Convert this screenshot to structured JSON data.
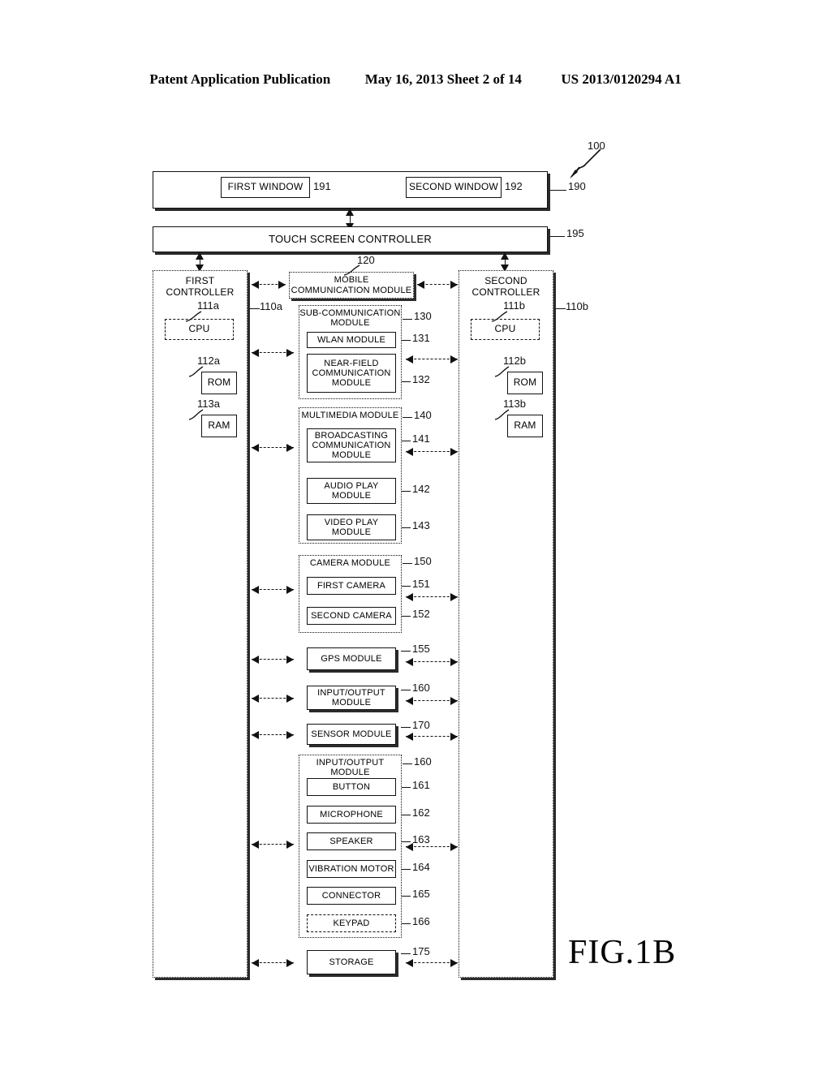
{
  "header": {
    "publication": "Patent Application Publication",
    "date_sheet": "May 16, 2013  Sheet 2 of 14",
    "patent_number": "US 2013/0120294 A1"
  },
  "figure": {
    "label": "FIG.1B",
    "device_ref": "100"
  },
  "display": {
    "ref": "190",
    "windows": [
      {
        "label": "FIRST WINDOW",
        "ref": "191"
      },
      {
        "label": "SECOND WINDOW",
        "ref": "192"
      }
    ]
  },
  "touch_screen_controller": {
    "label": "TOUCH SCREEN CONTROLLER",
    "ref": "195"
  },
  "controllers": [
    {
      "label_line1": "FIRST",
      "label_line2": "CONTROLLER",
      "ref": "110a",
      "cpu": {
        "label": "CPU",
        "ref": "111a"
      },
      "rom": {
        "label": "ROM",
        "ref": "112a"
      },
      "ram": {
        "label": "RAM",
        "ref": "113a"
      }
    },
    {
      "label_line1": "SECOND",
      "label_line2": "CONTROLLER",
      "ref": "110b",
      "cpu": {
        "label": "CPU",
        "ref": "111b"
      },
      "rom": {
        "label": "ROM",
        "ref": "112b"
      },
      "ram": {
        "label": "RAM",
        "ref": "113b"
      }
    }
  ],
  "modules": {
    "mobile_communication": {
      "line1": "MOBILE",
      "line2": "COMMUNICATION MODULE",
      "ref": "120"
    },
    "sub_communication": {
      "line1": "SUB-COMMUNICATION",
      "line2": "MODULE",
      "ref": "130",
      "children": [
        {
          "label": "WLAN MODULE",
          "ref": "131"
        },
        {
          "line1": "NEAR-FIELD",
          "line2": "COMMUNICATION",
          "line3": "MODULE",
          "ref": "132"
        }
      ]
    },
    "multimedia": {
      "label": "MULTIMEDIA MODULE",
      "ref": "140",
      "children": [
        {
          "line1": "BROADCASTING",
          "line2": "COMMUNICATION",
          "line3": "MODULE",
          "ref": "141"
        },
        {
          "line1": "AUDIO PLAY",
          "line2": "MODULE",
          "ref": "142"
        },
        {
          "line1": "VIDEO PLAY",
          "line2": "MODULE",
          "ref": "143"
        }
      ]
    },
    "camera": {
      "label": "CAMERA MODULE",
      "ref": "150",
      "children": [
        {
          "label": "FIRST CAMERA",
          "ref": "151"
        },
        {
          "label": "SECOND CAMERA",
          "ref": "152"
        }
      ]
    },
    "gps": {
      "label": "GPS MODULE",
      "ref": "155"
    },
    "input_output_summary": {
      "line1": "INPUT/OUTPUT",
      "line2": "MODULE",
      "ref": "160"
    },
    "sensor": {
      "label": "SENSOR MODULE",
      "ref": "170"
    },
    "input_output": {
      "label": "INPUT/OUTPUT MODULE",
      "ref": "160",
      "children": [
        {
          "label": "BUTTON",
          "ref": "161"
        },
        {
          "label": "MICROPHONE",
          "ref": "162"
        },
        {
          "label": "SPEAKER",
          "ref": "163"
        },
        {
          "label": "VIBRATION MOTOR",
          "ref": "164"
        },
        {
          "label": "CONNECTOR",
          "ref": "165"
        },
        {
          "label": "KEYPAD",
          "ref": "166"
        }
      ]
    },
    "storage": {
      "label": "STORAGE",
      "ref": "175"
    }
  }
}
